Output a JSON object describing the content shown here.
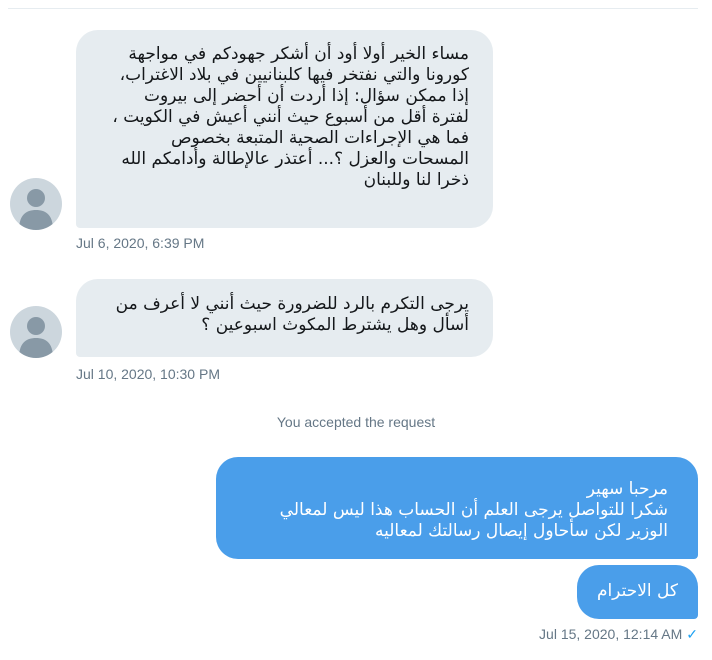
{
  "messages": [
    {
      "lines": [
        "مساء الخير أولا أود أن أشكر جهودكم في مواجهة",
        "كورونا والتي نفتخر فيها كلبنانيين في بلاد الاغتراب،",
        "إذا ممكن سؤال: إذا أردت أن أحضر إلى بيروت",
        "لفترة أقل من أسبوع حيث أنني أعيش في الكويت ،",
        "فما هي الإجراءات الصحية المتبعة بخصوص",
        "المسحات والعزل ؟... أعتذر عالإطالة وأدامكم الله",
        "ذخرا لنا وللبنان"
      ],
      "timestamp": "Jul 6, 2020, 6:39 PM"
    },
    {
      "lines": [
        "يرجى التكرم بالرد للضرورة حيث أنني لا أعرف من",
        "أسأل وهل يشترط المكوث اسبوعين ؟"
      ],
      "timestamp": "Jul 10, 2020, 10:30 PM"
    }
  ],
  "system_note": "You accepted the request",
  "replies": [
    {
      "lines": [
        "مرحبا سهير",
        "شكرا للتواصل يرجى العلم أن الحساب هذا ليس لمعالي",
        "الوزير لكن سأحاول إيصال رسالتك لمعاليه"
      ]
    },
    {
      "lines": [
        "كل الاحترام"
      ]
    }
  ],
  "reply_timestamp": "Jul 15, 2020, 12:14 AM",
  "read_status_icon": "checkmark-icon",
  "colors": {
    "incoming_bubble": "#e6ecf0",
    "outgoing_bubble": "#4a9eea",
    "timestamp": "#657786",
    "check": "#1da1f2"
  }
}
